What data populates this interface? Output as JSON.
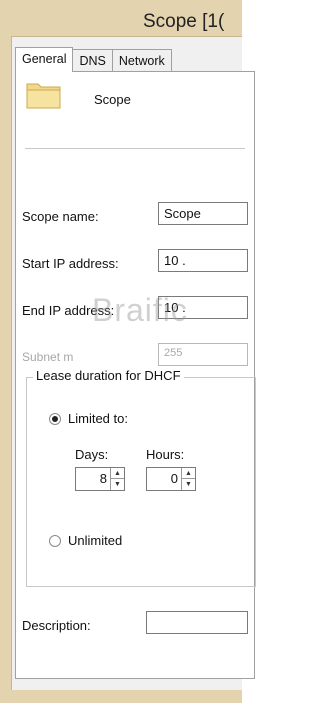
{
  "window": {
    "title": "Scope [1(",
    "frame_color": "#e3d3ae"
  },
  "tabs": [
    {
      "label": "General",
      "active": true
    },
    {
      "label": "DNS",
      "active": false
    },
    {
      "label": "Network",
      "active": false
    }
  ],
  "general": {
    "heading": "Scope",
    "icon": "folder-icon",
    "scope_name_label": "Scope name:",
    "scope_name_value": "Scope",
    "start_ip_label": "Start IP address:",
    "start_ip_value": "10 .",
    "end_ip_label": "End IP address:",
    "end_ip_value": "10 .",
    "subnet_label": "Subnet m",
    "subnet_value": "255",
    "lease": {
      "legend": "Lease duration for DHCF",
      "limited_label": "Limited to:",
      "limited_selected": true,
      "days_label": "Days:",
      "days_value": "8",
      "hours_label": "Hours:",
      "hours_value": "0",
      "unlimited_label": "Unlimited",
      "unlimited_selected": false
    },
    "description_label": "Description:",
    "description_value": ""
  },
  "watermark": "Braific"
}
